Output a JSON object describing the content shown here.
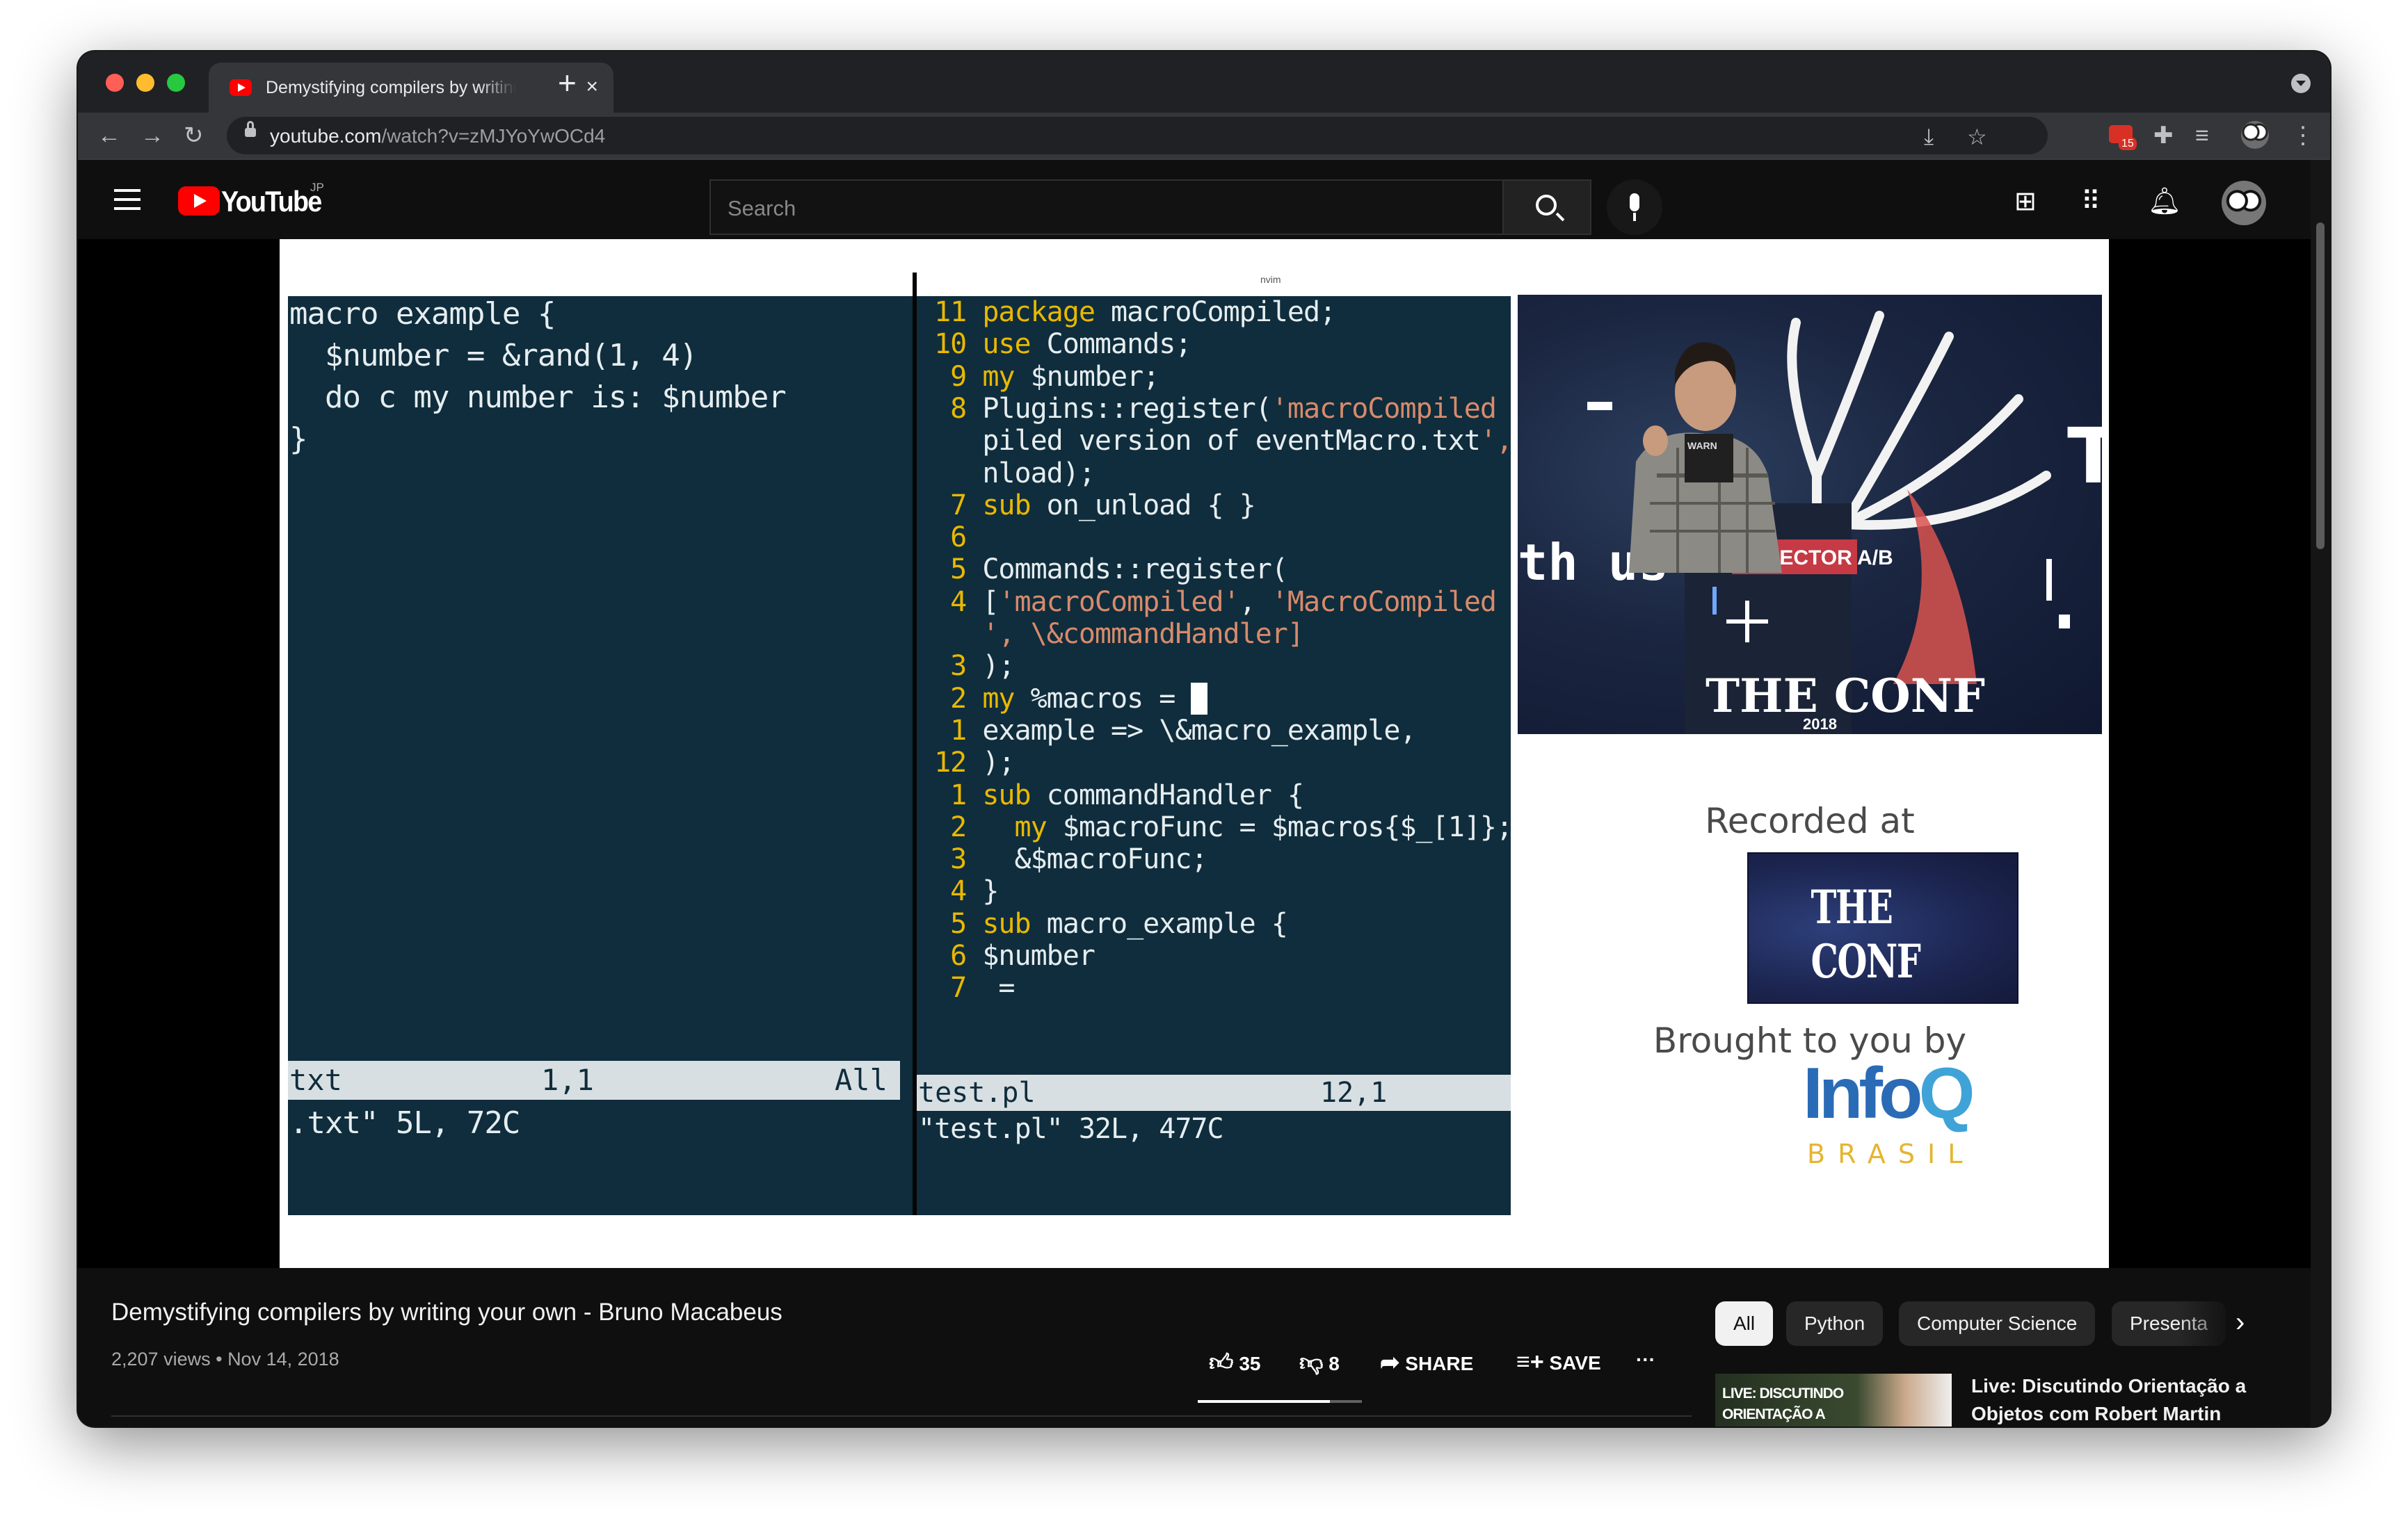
{
  "browser": {
    "tab_title": "Demystifying compilers by writing your own",
    "tab_close": "×",
    "new_tab": "+",
    "url_host": "youtube.com",
    "url_path": "/watch?v=zMJYoYwOCd4",
    "extension_badge": "15"
  },
  "youtube": {
    "logo_text": "YouTube",
    "region": "JP",
    "search_placeholder": "Search"
  },
  "slide": {
    "nvim_label": "nvim",
    "left_code": [
      "macro example {",
      "  $number = &rand(1, 4)",
      "  do c my number is: $number",
      "}"
    ],
    "left_status": {
      "file": "txt",
      "pos": "1,1",
      "scroll": "All"
    },
    "left_message": ".txt\" 5L, 72C",
    "right_code": [
      {
        "n": "11",
        "code": "package macroCompiled;"
      },
      {
        "n": "10",
        "code": "use Commands;"
      },
      {
        "n": "9",
        "code": "my $number;"
      },
      {
        "n": "8",
        "code": "Plugins::register('macroCompiled"
      },
      {
        "n": "",
        "code": "piled version of eventMacro.txt',"
      },
      {
        "n": "",
        "code": "nload);"
      },
      {
        "n": "7",
        "code": "sub on_unload { }"
      },
      {
        "n": "6",
        "code": ""
      },
      {
        "n": "5",
        "code": "Commands::register("
      },
      {
        "n": "4",
        "code": "['macroCompiled', 'MacroCompiled"
      },
      {
        "n": "",
        "code": "', \\&commandHandler]"
      },
      {
        "n": "3",
        "code": ");"
      },
      {
        "n": "2",
        "code": "my %macros = "
      },
      {
        "n": "1",
        "code": "example => \\&macro_example,"
      },
      {
        "n": "12",
        "code": ");"
      },
      {
        "n": "1",
        "code": "sub commandHandler {"
      },
      {
        "n": "2",
        "code": "  my $macroFunc = $macros{$_[1]};"
      },
      {
        "n": "3",
        "code": "  &$macroFunc;"
      },
      {
        "n": "4",
        "code": "}"
      },
      {
        "n": "5",
        "code": "sub macro_example {"
      },
      {
        "n": "6",
        "code": "$number"
      },
      {
        "n": "7",
        "code": " ="
      }
    ],
    "right_status": {
      "file": "test.pl",
      "pos": "12,1"
    },
    "right_message": "\"test.pl\" 32L, 477C",
    "photo_text": {
      "sign": "SELECTOR A/B",
      "brand": "THE CONF",
      "year": "2018",
      "wall": "th us",
      "edge": "TI",
      "shirt": "WARN"
    },
    "recorded_at": "Recorded at",
    "conf_logo": "THE CONF",
    "brought_by": "Brought to you by",
    "infoq_a": "Info",
    "infoq_b": "Q",
    "infoq_sub": "BRASIL"
  },
  "video": {
    "title": "Demystifying compilers by writing your own - Bruno Macabeus",
    "views": "2,207 views",
    "date": "Nov 14, 2018",
    "likes": "35",
    "dislikes": "8",
    "share": "SHARE",
    "save": "SAVE",
    "more": "···"
  },
  "chips": [
    "All",
    "Python",
    "Computer Science",
    "Presenta"
  ],
  "recommendation": {
    "thumb_text": "LIVE: DISCUTINDO ORIENTAÇÃO A",
    "title": "Live: Discutindo Orientação a Objetos com Robert Martin"
  }
}
